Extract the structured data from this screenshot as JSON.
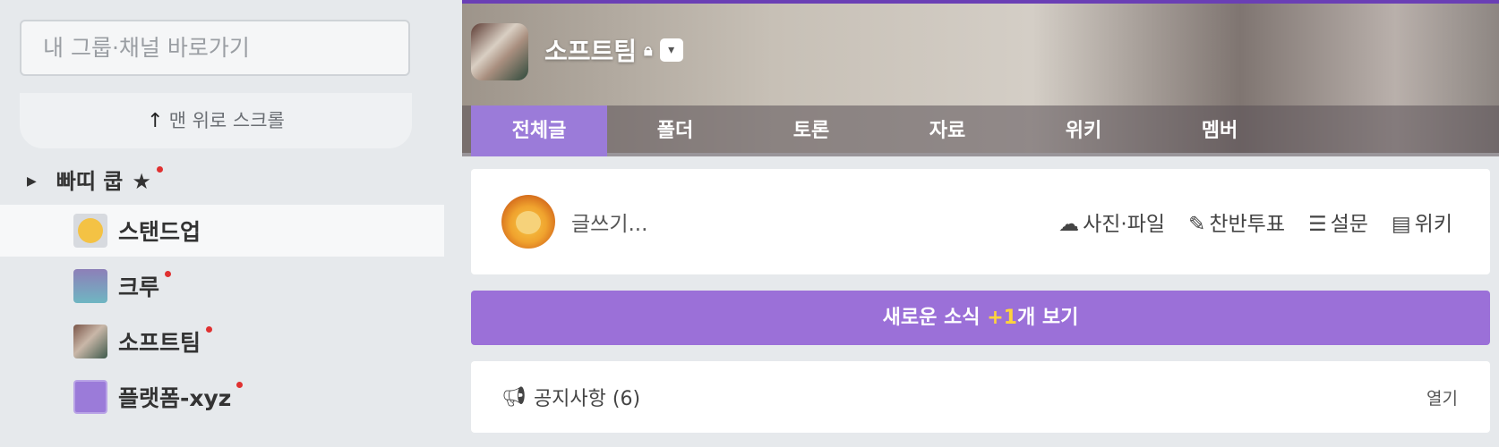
{
  "sidebar": {
    "search_placeholder": "내 그룹·채널 바로가기",
    "scroll_top_label": "맨 위로 스크롤",
    "group": {
      "name": "빠띠 쿱",
      "star": "★"
    },
    "channels": [
      {
        "name": "스탠드업",
        "icon": "smile-icon",
        "unread": false,
        "active": true
      },
      {
        "name": "크루",
        "icon": "crew-icon",
        "unread": true,
        "active": false
      },
      {
        "name": "소프트팀",
        "icon": "photo-icon",
        "unread": true,
        "active": false
      },
      {
        "name": "플랫폼-xyz",
        "icon": "parti-icon",
        "unread": true,
        "active": false
      }
    ]
  },
  "header": {
    "title": "소프트팀",
    "lock_icon": "lock-icon",
    "dropdown_icon": "chevron-down-icon"
  },
  "tabs": [
    "전체글",
    "폴더",
    "토론",
    "자료",
    "위키",
    "멤버"
  ],
  "composer": {
    "placeholder": "글쓰기...",
    "actions": [
      {
        "label": "사진·파일",
        "icon": "cloud-upload-icon"
      },
      {
        "label": "찬반투표",
        "icon": "vote-icon"
      },
      {
        "label": "설문",
        "icon": "list-icon"
      },
      {
        "label": "위키",
        "icon": "wiki-doc-icon"
      }
    ]
  },
  "news": {
    "prefix": "새로운 소식",
    "count": "+1",
    "suffix": "개 보기"
  },
  "notice": {
    "label": "공지사항 (6)",
    "open": "열기"
  },
  "colors": {
    "accent": "#9b70d8",
    "tab_active": "#9b7bd9",
    "unread_dot": "#e03131",
    "badge": "#ffd43b"
  }
}
